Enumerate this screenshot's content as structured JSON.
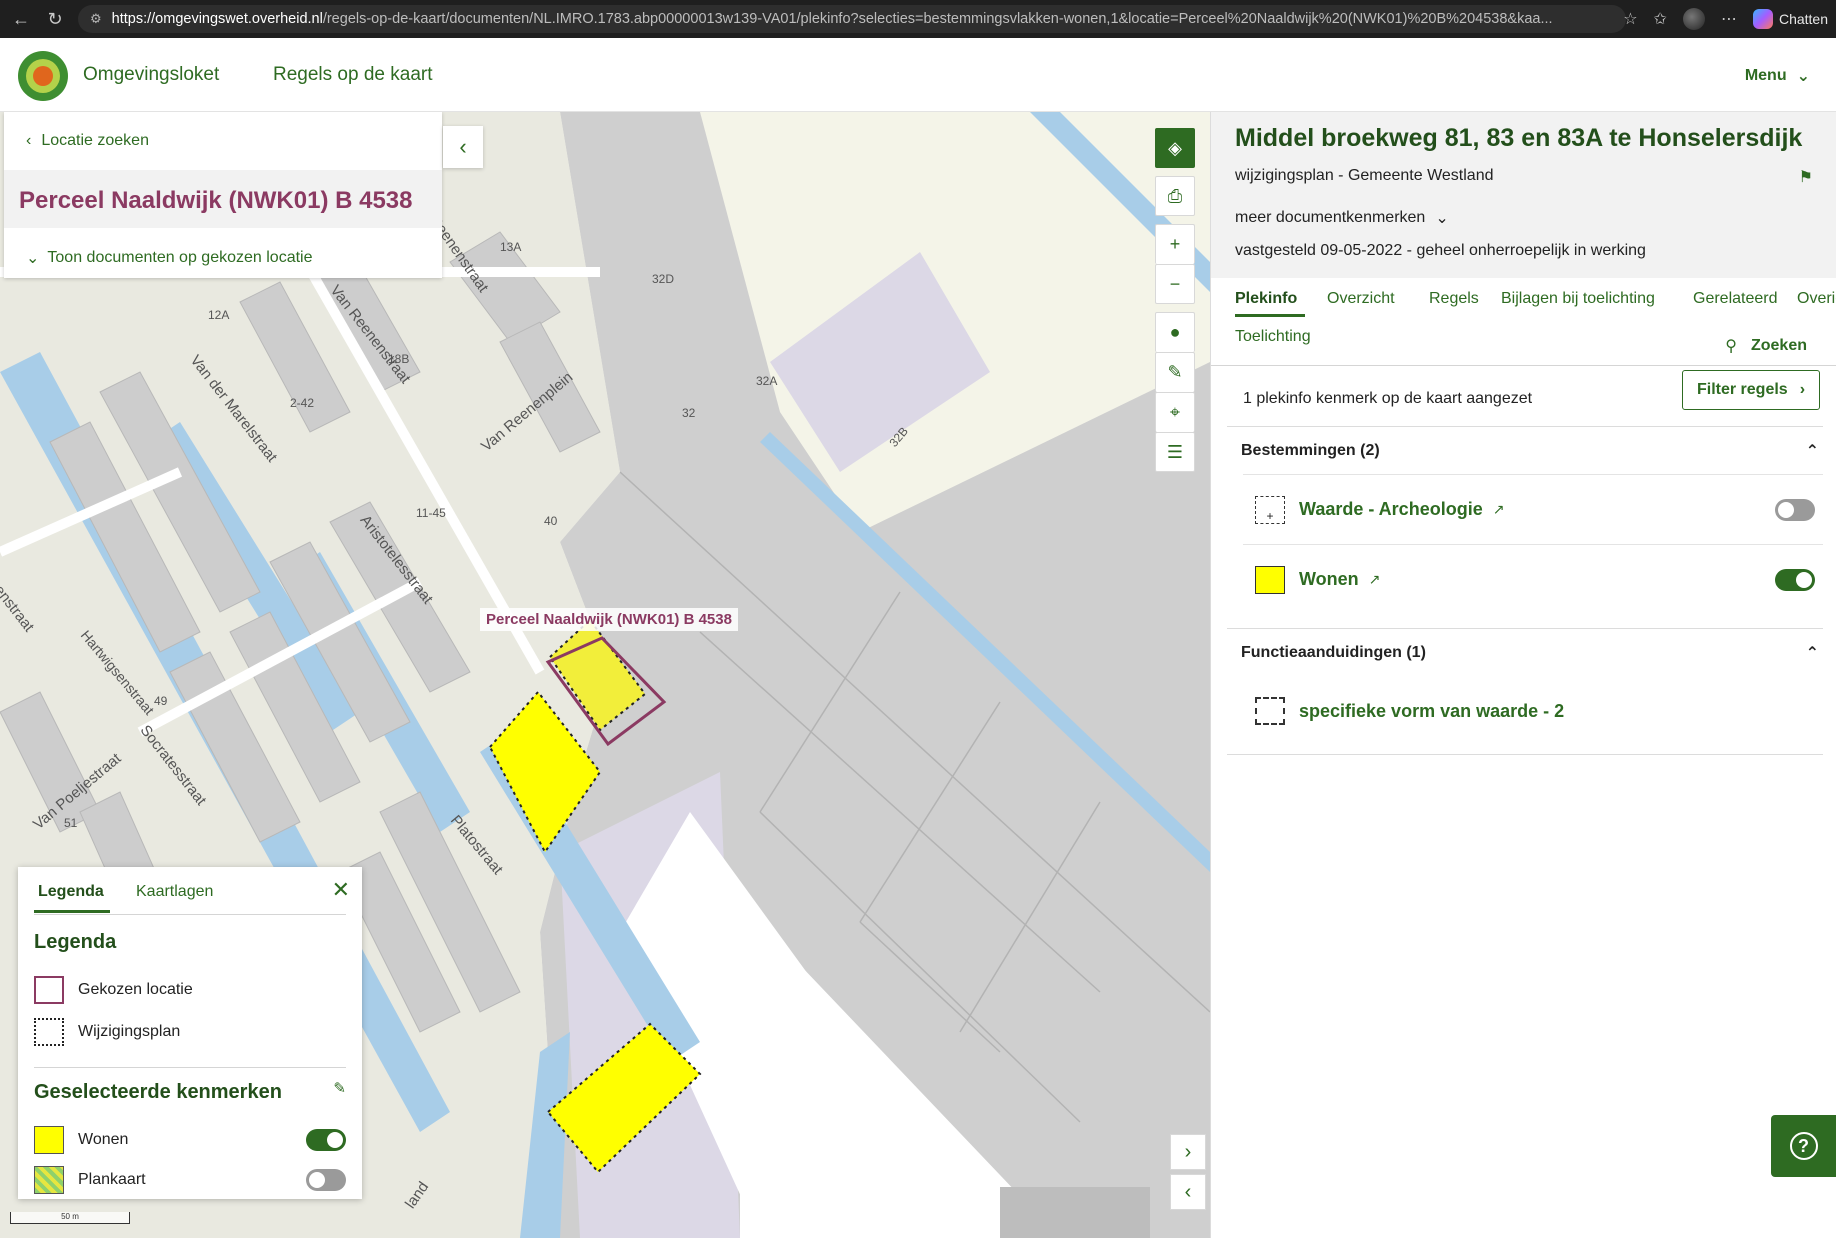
{
  "browser": {
    "url_host": "https://omgevingswet.overheid.nl",
    "url_path": "/regels-op-de-kaart/documenten/NL.IMRO.1783.abp00000013w139-VA01/plekinfo?selecties=bestemmingsvlakken-wonen,1&locatie=Perceel%20Naaldwijk%20(NWK01)%20B%204538&kaa...",
    "profile_label": "Chatten"
  },
  "header": {
    "brand": "Omgevingsloket",
    "app_title": "Regels op de kaart",
    "menu_label": "Menu"
  },
  "location": {
    "back_label": "Locatie zoeken",
    "title": "Perceel Naaldwijk (NWK01) B 4538",
    "docs_toggle": "Toon documenten op gekozen locatie",
    "map_label": "Perceel Naaldwijk (NWK01) B 4538"
  },
  "map": {
    "streets": [
      "Hartwigsenstraat",
      "Van der Marelstraat",
      "Van Reenenstraat",
      "Reenenstraat",
      "Van Reenenplein",
      "Aristotelesstraat",
      "Socratesstraat",
      "Van Poeljestraat",
      "Platostraat",
      "enstraat",
      "land"
    ],
    "numbers": [
      "32D",
      "32A",
      "32",
      "32B",
      "40",
      "11-45",
      "2-42",
      "12A",
      "13A",
      "18B",
      "49",
      "51"
    ],
    "scale_label": "50 m"
  },
  "legend": {
    "tabs": [
      "Legenda",
      "Kaartlagen"
    ],
    "heading": "Legenda",
    "items": [
      {
        "label": "Gekozen locatie"
      },
      {
        "label": "Wijzigingsplan"
      }
    ],
    "selected_heading": "Geselecteerde kenmerken",
    "selected": [
      {
        "label": "Wonen",
        "on": true
      },
      {
        "label": "Plankaart",
        "on": false
      }
    ]
  },
  "document": {
    "title": "Middel broekweg 81, 83 en 83A te Honselersdijk",
    "subtitle": "wijzigingsplan - Gemeente Westland",
    "more_label": "meer documentkenmerken",
    "status": "vastgesteld 09-05-2022 - geheel onherroepelijk in werking"
  },
  "tabs": [
    "Plekinfo",
    "Overzicht",
    "Regels",
    "Bijlagen bij toelichting",
    "Gerelateerd",
    "Overig",
    "Toelichting"
  ],
  "search_label": "Zoeken",
  "plekinfo": {
    "count_text": "1 plekinfo kenmerk op de kaart aangezet",
    "filter_label": "Filter regels",
    "sections": [
      {
        "title": "Bestemmingen (2)",
        "items": [
          {
            "name": "Waarde - Archeologie",
            "on": false
          },
          {
            "name": "Wonen",
            "on": true
          }
        ]
      },
      {
        "title": "Functieaanduidingen (1)",
        "items": [
          {
            "name": "specifieke vorm van waarde - 2"
          }
        ]
      }
    ]
  },
  "colors": {
    "brand_green": "#2e6b22",
    "perceel": "#8b3a62",
    "wonen": "#ffff00"
  }
}
